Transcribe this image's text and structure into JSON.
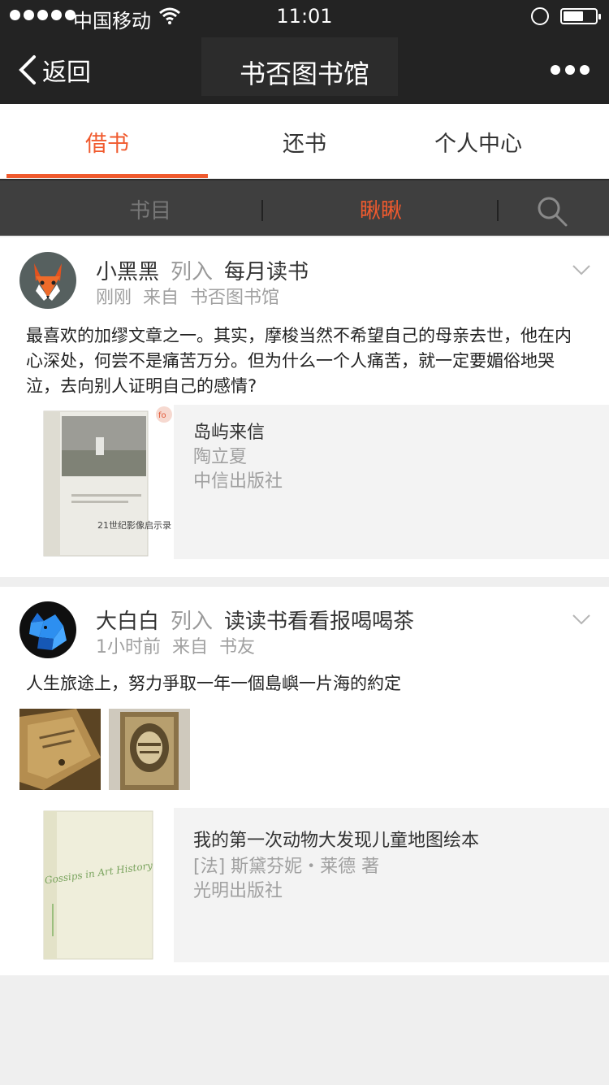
{
  "status_bar": {
    "carrier": "中国移动",
    "time": "11:01"
  },
  "nav": {
    "back_label": "返回",
    "title": "书否图书馆"
  },
  "tabs": [
    {
      "label": "借书"
    },
    {
      "label": "还书"
    },
    {
      "label": "个人中心"
    }
  ],
  "subnav": [
    {
      "label": "书目"
    },
    {
      "label": "瞅瞅"
    }
  ],
  "feed": [
    {
      "user": "小黑黑",
      "verb": "列入",
      "list": "每月读书",
      "time": "刚刚",
      "from_label": "来自",
      "source": "书否图书馆",
      "text": "最喜欢的加缪文章之一。其实，摩梭当然不希望自己的母亲去世，他在内心深处，何尝不是痛苦万分。但为什么一个人痛苦，就一定要媚俗地哭泣，去向别人证明自己的感情?",
      "book": {
        "title": "岛屿来信",
        "author": "陶立夏",
        "publisher": "中信出版社",
        "cover_caption": "21世纪影像启示录",
        "badge": "fo"
      }
    },
    {
      "user": "大白白",
      "verb": "列入",
      "list": "读读书看看报喝喝茶",
      "time": "1小时前",
      "from_label": "来自",
      "source": "书友",
      "text": "人生旅途上，努力爭取一年一個島嶼一片海的約定",
      "book": {
        "title": "我的第一次动物大发现儿童地图绘本",
        "author": "[法] 斯黛芬妮・莱德 著",
        "publisher": "光明出版社",
        "cover_caption": "Gossips in Art History"
      }
    }
  ],
  "colors": {
    "accent": "#f05a2e",
    "header": "#232323",
    "subbar": "#3f3f3f"
  }
}
